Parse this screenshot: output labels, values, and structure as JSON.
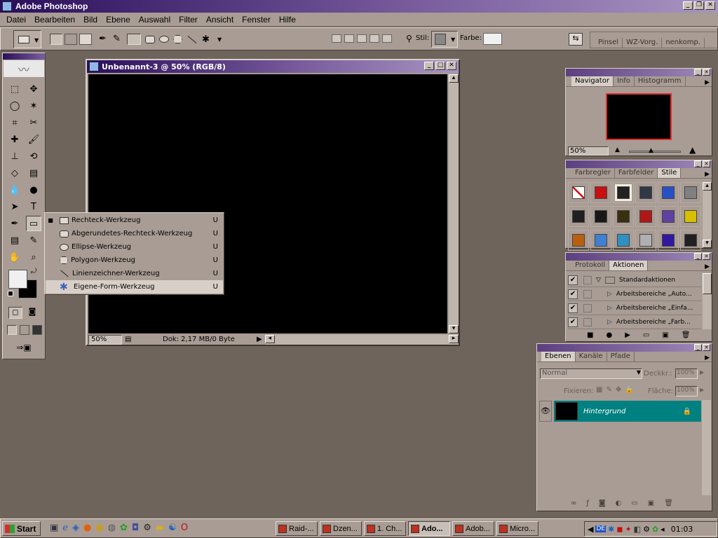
{
  "app": {
    "title": "Adobe Photoshop"
  },
  "menu": [
    "Datei",
    "Bearbeiten",
    "Bild",
    "Ebene",
    "Auswahl",
    "Filter",
    "Ansicht",
    "Fenster",
    "Hilfe"
  ],
  "options_bar": {
    "stil_label": "Stil:",
    "farbe_label": "Farbe:",
    "tabs": [
      "Pinsel",
      "WZ-Vorg.",
      "nenkomp."
    ]
  },
  "document": {
    "title": "Unbenannt-3 @ 50% (RGB/8)",
    "zoom": "50%",
    "status": "Dok: 2,17 MB/0 Byte"
  },
  "flyout": {
    "items": [
      {
        "label": "Rechteck-Werkzeug",
        "shortcut": "U",
        "icon": "rectangle-icon",
        "selected": true
      },
      {
        "label": "Abgerundetes-Rechteck-Werkzeug",
        "shortcut": "U",
        "icon": "rounded-rect-icon"
      },
      {
        "label": "Ellipse-Werkzeug",
        "shortcut": "U",
        "icon": "ellipse-icon"
      },
      {
        "label": "Polygon-Werkzeug",
        "shortcut": "U",
        "icon": "polygon-icon"
      },
      {
        "label": "Linienzeichner-Werkzeug",
        "shortcut": "U",
        "icon": "line-icon"
      },
      {
        "label": "Eigene-Form-Werkzeug",
        "shortcut": "U",
        "icon": "custom-shape-icon",
        "highlighted": true
      }
    ]
  },
  "navigator": {
    "tabs": [
      "Navigator",
      "Info",
      "Histogramm"
    ],
    "zoom": "50%"
  },
  "styles": {
    "tabs": [
      "Farbregler",
      "Farbfelder",
      "Stile"
    ],
    "swatches": [
      "#ffffff",
      "#c81010",
      "#222222",
      "#303848",
      "#2850c8",
      "#808080",
      "#202020",
      "#181818",
      "#3a3010",
      "#b01818",
      "#6040a0",
      "#d8c000",
      "#b86010",
      "#4080d0",
      "#3090c0",
      "#b0b0b0",
      "#3018a0",
      "#202020"
    ]
  },
  "actions": {
    "tabs": [
      "Protokoll",
      "Aktionen"
    ],
    "rows": [
      {
        "label": "Standardaktionen",
        "type": "folder"
      },
      {
        "label": "Arbeitsbereiche „Auto...",
        "type": "action"
      },
      {
        "label": "Arbeitsbereiche „Einfa...",
        "type": "action"
      },
      {
        "label": "Arbeitsbereiche „Farb...",
        "type": "action"
      }
    ]
  },
  "layers": {
    "tabs": [
      "Ebenen",
      "Kanäle",
      "Pfade"
    ],
    "blend_mode": "Normal",
    "opacity_label": "Deckkr.:",
    "opacity": "100%",
    "lock_label": "Fixieren:",
    "fill_label": "Fläche:",
    "fill": "100%",
    "items": [
      {
        "name": "Hintergrund",
        "highlight": "#008080"
      }
    ]
  },
  "taskbar": {
    "start": "Start",
    "tasks": [
      "Raid-...",
      "Dzen...",
      "1. Ch...",
      "Ado...",
      "Adob...",
      "Micro..."
    ],
    "active_task": 3,
    "lang": "DE",
    "time": "01:03"
  }
}
